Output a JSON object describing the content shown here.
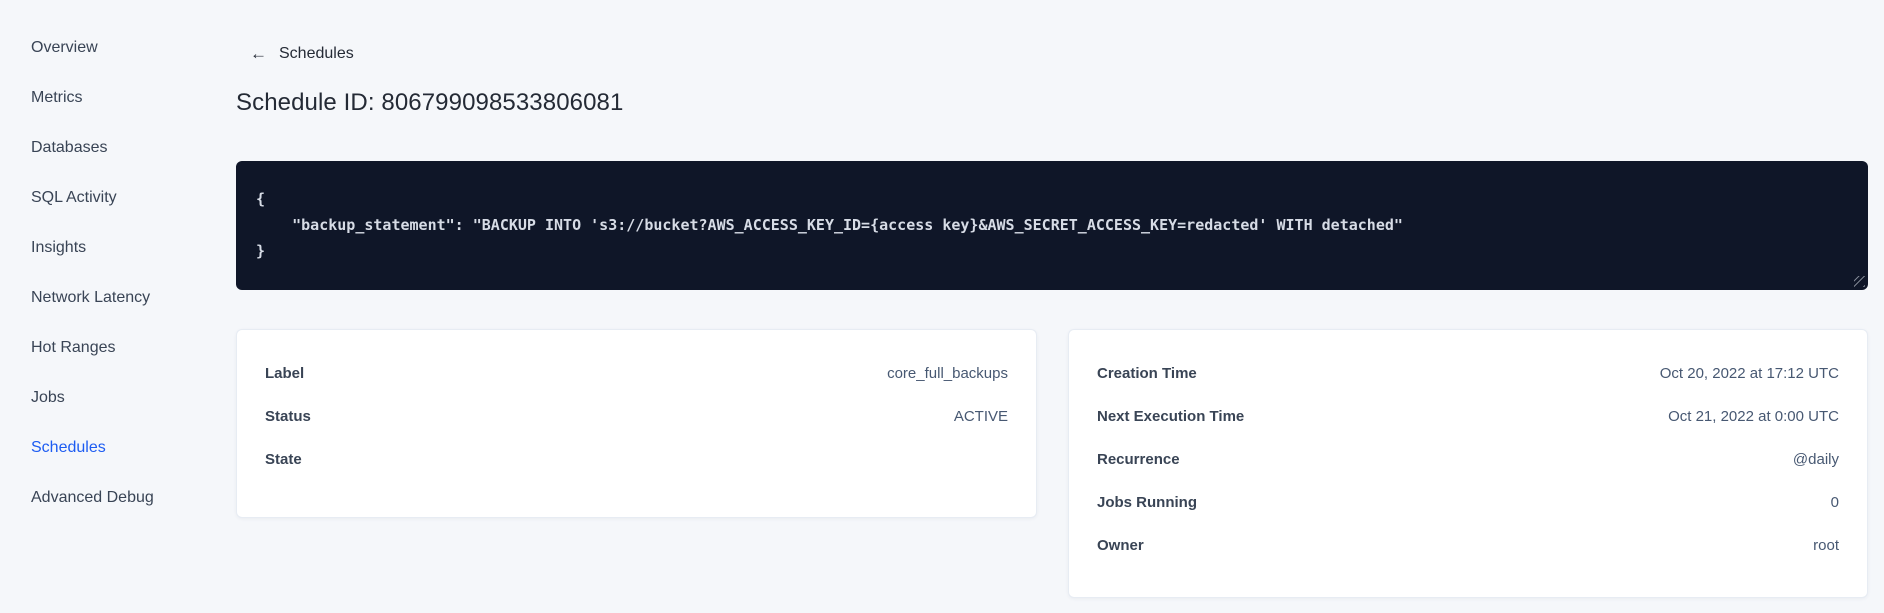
{
  "sidebar": {
    "items": [
      {
        "label": "Overview"
      },
      {
        "label": "Metrics"
      },
      {
        "label": "Databases"
      },
      {
        "label": "SQL Activity"
      },
      {
        "label": "Insights"
      },
      {
        "label": "Network Latency"
      },
      {
        "label": "Hot Ranges"
      },
      {
        "label": "Jobs"
      },
      {
        "label": "Schedules"
      },
      {
        "label": "Advanced Debug"
      }
    ],
    "active_item": "Schedules"
  },
  "header": {
    "back_icon": "←",
    "back_label": "Schedules",
    "title": "Schedule ID: 806799098533806081"
  },
  "code_block": {
    "lines": [
      "{",
      "    \"backup_statement\": \"BACKUP INTO 's3://bucket?AWS_ACCESS_KEY_ID={access key}&AWS_SECRET_ACCESS_KEY=redacted' WITH detached\"",
      "}"
    ]
  },
  "details_left": {
    "rows": [
      {
        "label": "Label",
        "value": "core_full_backups"
      },
      {
        "label": "Status",
        "value": "ACTIVE"
      },
      {
        "label": "State",
        "value": ""
      }
    ]
  },
  "details_right": {
    "rows": [
      {
        "label": "Creation Time",
        "value": "Oct 20, 2022 at 17:12 UTC"
      },
      {
        "label": "Next Execution Time",
        "value": "Oct 21, 2022 at 0:00 UTC"
      },
      {
        "label": "Recurrence",
        "value": "@daily"
      },
      {
        "label": "Jobs Running",
        "value": "0"
      },
      {
        "label": "Owner",
        "value": "root"
      }
    ]
  },
  "colors": {
    "accent_blue": "#1d5cf2",
    "page_background": "#f5f7fa",
    "code_background": "#0f1628",
    "code_text": "#d7dce6",
    "text_primary": "#242a35",
    "text_secondary": "#475872"
  }
}
